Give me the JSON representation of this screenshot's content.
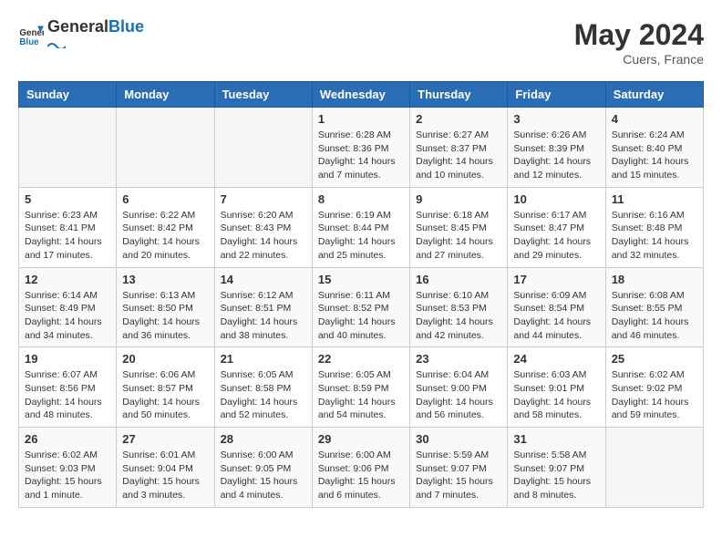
{
  "header": {
    "logo_general": "General",
    "logo_blue": "Blue",
    "month_year": "May 2024",
    "location": "Cuers, France"
  },
  "days_of_week": [
    "Sunday",
    "Monday",
    "Tuesday",
    "Wednesday",
    "Thursday",
    "Friday",
    "Saturday"
  ],
  "weeks": [
    [
      {
        "day": "",
        "info": ""
      },
      {
        "day": "",
        "info": ""
      },
      {
        "day": "",
        "info": ""
      },
      {
        "day": "1",
        "info": "Sunrise: 6:28 AM\nSunset: 8:36 PM\nDaylight: 14 hours\nand 7 minutes."
      },
      {
        "day": "2",
        "info": "Sunrise: 6:27 AM\nSunset: 8:37 PM\nDaylight: 14 hours\nand 10 minutes."
      },
      {
        "day": "3",
        "info": "Sunrise: 6:26 AM\nSunset: 8:39 PM\nDaylight: 14 hours\nand 12 minutes."
      },
      {
        "day": "4",
        "info": "Sunrise: 6:24 AM\nSunset: 8:40 PM\nDaylight: 14 hours\nand 15 minutes."
      }
    ],
    [
      {
        "day": "5",
        "info": "Sunrise: 6:23 AM\nSunset: 8:41 PM\nDaylight: 14 hours\nand 17 minutes."
      },
      {
        "day": "6",
        "info": "Sunrise: 6:22 AM\nSunset: 8:42 PM\nDaylight: 14 hours\nand 20 minutes."
      },
      {
        "day": "7",
        "info": "Sunrise: 6:20 AM\nSunset: 8:43 PM\nDaylight: 14 hours\nand 22 minutes."
      },
      {
        "day": "8",
        "info": "Sunrise: 6:19 AM\nSunset: 8:44 PM\nDaylight: 14 hours\nand 25 minutes."
      },
      {
        "day": "9",
        "info": "Sunrise: 6:18 AM\nSunset: 8:45 PM\nDaylight: 14 hours\nand 27 minutes."
      },
      {
        "day": "10",
        "info": "Sunrise: 6:17 AM\nSunset: 8:47 PM\nDaylight: 14 hours\nand 29 minutes."
      },
      {
        "day": "11",
        "info": "Sunrise: 6:16 AM\nSunset: 8:48 PM\nDaylight: 14 hours\nand 32 minutes."
      }
    ],
    [
      {
        "day": "12",
        "info": "Sunrise: 6:14 AM\nSunset: 8:49 PM\nDaylight: 14 hours\nand 34 minutes."
      },
      {
        "day": "13",
        "info": "Sunrise: 6:13 AM\nSunset: 8:50 PM\nDaylight: 14 hours\nand 36 minutes."
      },
      {
        "day": "14",
        "info": "Sunrise: 6:12 AM\nSunset: 8:51 PM\nDaylight: 14 hours\nand 38 minutes."
      },
      {
        "day": "15",
        "info": "Sunrise: 6:11 AM\nSunset: 8:52 PM\nDaylight: 14 hours\nand 40 minutes."
      },
      {
        "day": "16",
        "info": "Sunrise: 6:10 AM\nSunset: 8:53 PM\nDaylight: 14 hours\nand 42 minutes."
      },
      {
        "day": "17",
        "info": "Sunrise: 6:09 AM\nSunset: 8:54 PM\nDaylight: 14 hours\nand 44 minutes."
      },
      {
        "day": "18",
        "info": "Sunrise: 6:08 AM\nSunset: 8:55 PM\nDaylight: 14 hours\nand 46 minutes."
      }
    ],
    [
      {
        "day": "19",
        "info": "Sunrise: 6:07 AM\nSunset: 8:56 PM\nDaylight: 14 hours\nand 48 minutes."
      },
      {
        "day": "20",
        "info": "Sunrise: 6:06 AM\nSunset: 8:57 PM\nDaylight: 14 hours\nand 50 minutes."
      },
      {
        "day": "21",
        "info": "Sunrise: 6:05 AM\nSunset: 8:58 PM\nDaylight: 14 hours\nand 52 minutes."
      },
      {
        "day": "22",
        "info": "Sunrise: 6:05 AM\nSunset: 8:59 PM\nDaylight: 14 hours\nand 54 minutes."
      },
      {
        "day": "23",
        "info": "Sunrise: 6:04 AM\nSunset: 9:00 PM\nDaylight: 14 hours\nand 56 minutes."
      },
      {
        "day": "24",
        "info": "Sunrise: 6:03 AM\nSunset: 9:01 PM\nDaylight: 14 hours\nand 58 minutes."
      },
      {
        "day": "25",
        "info": "Sunrise: 6:02 AM\nSunset: 9:02 PM\nDaylight: 14 hours\nand 59 minutes."
      }
    ],
    [
      {
        "day": "26",
        "info": "Sunrise: 6:02 AM\nSunset: 9:03 PM\nDaylight: 15 hours\nand 1 minute."
      },
      {
        "day": "27",
        "info": "Sunrise: 6:01 AM\nSunset: 9:04 PM\nDaylight: 15 hours\nand 3 minutes."
      },
      {
        "day": "28",
        "info": "Sunrise: 6:00 AM\nSunset: 9:05 PM\nDaylight: 15 hours\nand 4 minutes."
      },
      {
        "day": "29",
        "info": "Sunrise: 6:00 AM\nSunset: 9:06 PM\nDaylight: 15 hours\nand 6 minutes."
      },
      {
        "day": "30",
        "info": "Sunrise: 5:59 AM\nSunset: 9:07 PM\nDaylight: 15 hours\nand 7 minutes."
      },
      {
        "day": "31",
        "info": "Sunrise: 5:58 AM\nSunset: 9:07 PM\nDaylight: 15 hours\nand 8 minutes."
      },
      {
        "day": "",
        "info": ""
      }
    ]
  ]
}
